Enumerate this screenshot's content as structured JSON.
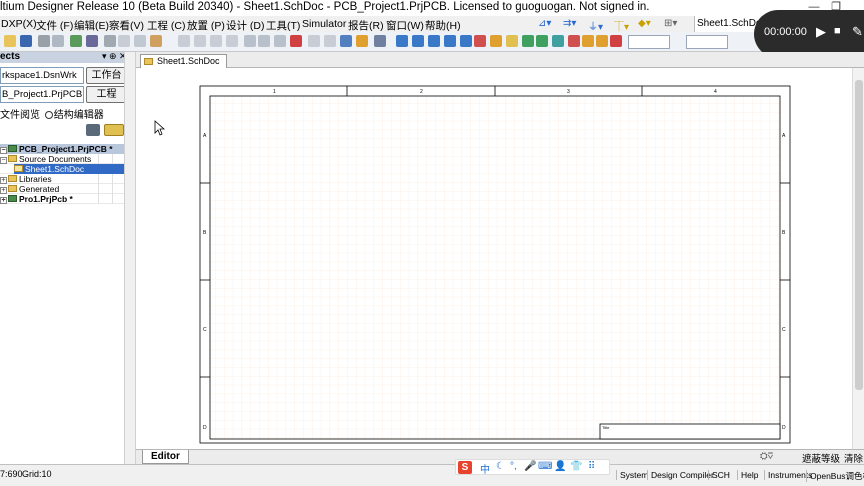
{
  "window": {
    "title": "ltium Designer Release 10 (Beta Build 20340) - Sheet1.SchDoc - PCB_Project1.PrjPCB. Licensed to guoguogan. Not signed in.",
    "minimize_glyph": "—",
    "restore_glyph": "❐"
  },
  "menu": {
    "items": [
      "DXP(X)",
      "文件 (F)",
      "编辑(E)",
      "察看(V)",
      "工程 (C)",
      "放置 (P)",
      "设计 (D)",
      "工具(T)",
      "Simulator",
      "报告(R)",
      "窗口(W)",
      "帮助(H)"
    ],
    "right_doc_tab": "Sheet1.SchDoc?L"
  },
  "recorder": {
    "time": "00:00:00",
    "play_glyph": "▶",
    "stop_glyph": "■",
    "pen_glyph": "✎"
  },
  "projects_panel": {
    "header": "ects",
    "pin_glyph": "▾ ⊕ ✕",
    "workspace_field": "rkspace1.DsnWrk",
    "workspace_button": "工作台",
    "project_field": "B_Project1.PrjPCB",
    "project_button": "工程",
    "radio_file_view": "文件阅览",
    "radio_structure": "结构编辑器",
    "tree": [
      {
        "label": "PCB_Project1.PrjPCB *",
        "kind": "project",
        "level": 0,
        "bold": true,
        "selected": true
      },
      {
        "label": "Source Documents",
        "kind": "folder",
        "level": 1,
        "bold": false,
        "selected": false
      },
      {
        "label": "Sheet1.SchDoc",
        "kind": "doc",
        "level": 2,
        "bold": false,
        "selected": true
      },
      {
        "label": "Libraries",
        "kind": "folder",
        "level": 1,
        "bold": false,
        "selected": false
      },
      {
        "label": "Generated",
        "kind": "folder",
        "level": 1,
        "bold": false,
        "selected": false
      },
      {
        "label": "Pro1.PrjPcb *",
        "kind": "project",
        "level": 0,
        "bold": true,
        "selected": false
      }
    ]
  },
  "document_tab": {
    "label": "Sheet1.SchDoc"
  },
  "sheet": {
    "top_zones": [
      "1",
      "2",
      "3",
      "4"
    ],
    "left_zones": [
      "A",
      "B",
      "C",
      "D"
    ],
    "title_block_label": "Title",
    "border_color": "#000000",
    "grid_color": "#fbe5d6"
  },
  "editor_tab": "Editor",
  "bottom_buttons": {
    "mask_level": "遮蔽等级",
    "clear": "清除"
  },
  "status": {
    "coords": "7:690",
    "grid": "Grid:10",
    "cells": [
      "System",
      "Design Compiler",
      "SCH",
      "Help",
      "Instruments",
      "OpenBus调色板"
    ]
  },
  "ime": {
    "logo": "S",
    "items": [
      "中",
      "☾",
      "°,",
      "🎤",
      "⌨",
      "👤",
      "👕",
      "⠿"
    ]
  },
  "colors": {
    "accent_selection": "#316ac5",
    "panel_header": "#c8d2e0",
    "recorder_bg": "#2b2b2b"
  }
}
